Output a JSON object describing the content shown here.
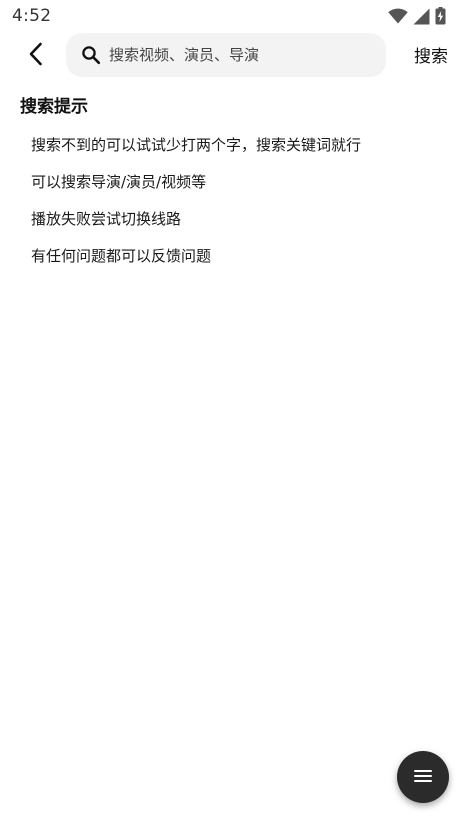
{
  "status_bar": {
    "time": "4:52",
    "icons": [
      "wifi-icon",
      "cellular-signal-icon",
      "battery-charging-icon"
    ]
  },
  "header": {
    "back_icon": "chevron-left-icon",
    "search": {
      "icon": "search-icon",
      "value": "",
      "placeholder": "搜索视频、演员、导演"
    },
    "search_button_label": "搜索"
  },
  "tips": {
    "title": "搜索提示",
    "items": [
      "搜索不到的可以试试少打两个字，搜索关键词就行",
      "可以搜索导演/演员/视频等",
      "播放失败尝试切换线路",
      "有任何问题都可以反馈问题"
    ]
  },
  "fab": {
    "icon": "menu-icon"
  },
  "colors": {
    "background": "#ffffff",
    "search_box_bg": "#f3f3f3",
    "text_primary": "#111111",
    "fab_bg": "#2b2b2b"
  }
}
